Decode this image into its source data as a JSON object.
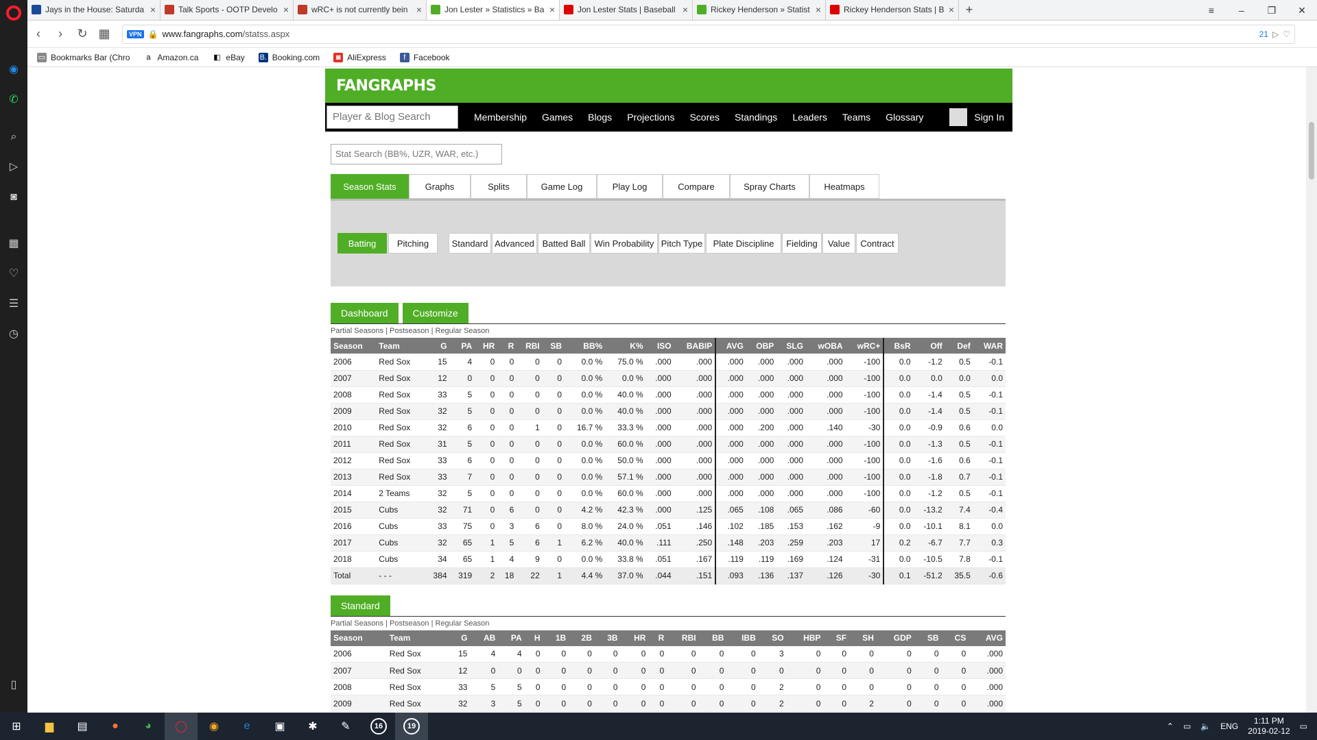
{
  "browser": {
    "tabs": [
      {
        "title": "Jays in the House: Saturda",
        "color": "#1a4a9a"
      },
      {
        "title": "Talk Sports - OOTP Develo",
        "color": "#c0392b"
      },
      {
        "title": "wRC+ is not currently bein",
        "color": "#c0392b"
      },
      {
        "title": "Jon Lester » Statistics » Ba",
        "color": "#50ae26"
      },
      {
        "title": "Jon Lester Stats | Baseball",
        "color": "#d00"
      },
      {
        "title": "Rickey Henderson » Statist",
        "color": "#50ae26"
      },
      {
        "title": "Rickey Henderson Stats | B",
        "color": "#d00"
      }
    ],
    "active_tab": 3,
    "url_domain": "www.fangraphs.com",
    "url_path": "/statss.aspx",
    "vpn_label": "VPN",
    "adblock_count": "21",
    "bookmarks": [
      {
        "label": "Bookmarks Bar (Chro",
        "icon": "folder-icon"
      },
      {
        "label": "Amazon.ca",
        "icon": "amazon-icon"
      },
      {
        "label": "eBay",
        "icon": "ebay-icon"
      },
      {
        "label": "Booking.com",
        "icon": "booking-icon"
      },
      {
        "label": "AliExpress",
        "icon": "aliexpress-icon"
      },
      {
        "label": "Facebook",
        "icon": "facebook-icon"
      }
    ]
  },
  "site": {
    "logo": "FANGRAPHS",
    "search_placeholder": "Player & Blog Search",
    "nav": [
      "Membership",
      "Games",
      "Blogs",
      "Projections",
      "Scores",
      "Standings",
      "Leaders",
      "Teams",
      "Glossary"
    ],
    "sign_in": "Sign In",
    "stat_search_placeholder": "Stat Search (BB%, UZR, WAR, etc.)",
    "main_tabs": [
      "Season Stats",
      "Graphs",
      "Splits",
      "Game Log",
      "Play Log",
      "Compare",
      "Spray Charts",
      "Heatmaps"
    ],
    "type_tabs": [
      "Batting",
      "Pitching"
    ],
    "stat_tabs": [
      "Standard",
      "Advanced",
      "Batted Ball",
      "Win Probability",
      "Pitch Type",
      "Plate Discipline",
      "Fielding",
      "Value",
      "Contract"
    ],
    "dashboard_label": "Dashboard",
    "customize_label": "Customize",
    "standard_label": "Standard",
    "subnav": [
      "Partial Seasons",
      "Postseason",
      "Regular Season"
    ],
    "accent": "#50ae26"
  },
  "dashboard": {
    "headers": [
      "Season",
      "Team",
      "G",
      "PA",
      "HR",
      "R",
      "RBI",
      "SB",
      "BB%",
      "K%",
      "ISO",
      "BABIP",
      "AVG",
      "OBP",
      "SLG",
      "wOBA",
      "wRC+",
      "BsR",
      "Off",
      "Def",
      "WAR"
    ],
    "rows": [
      [
        "2006",
        "Red Sox",
        "15",
        "4",
        "0",
        "0",
        "0",
        "0",
        "0.0 %",
        "75.0 %",
        ".000",
        ".000",
        ".000",
        ".000",
        ".000",
        ".000",
        "-100",
        "0.0",
        "-1.2",
        "0.5",
        "-0.1"
      ],
      [
        "2007",
        "Red Sox",
        "12",
        "0",
        "0",
        "0",
        "0",
        "0",
        "0.0 %",
        "0.0 %",
        ".000",
        ".000",
        ".000",
        ".000",
        ".000",
        ".000",
        "-100",
        "0.0",
        "0.0",
        "0.0",
        "0.0"
      ],
      [
        "2008",
        "Red Sox",
        "33",
        "5",
        "0",
        "0",
        "0",
        "0",
        "0.0 %",
        "40.0 %",
        ".000",
        ".000",
        ".000",
        ".000",
        ".000",
        ".000",
        "-100",
        "0.0",
        "-1.4",
        "0.5",
        "-0.1"
      ],
      [
        "2009",
        "Red Sox",
        "32",
        "5",
        "0",
        "0",
        "0",
        "0",
        "0.0 %",
        "40.0 %",
        ".000",
        ".000",
        ".000",
        ".000",
        ".000",
        ".000",
        "-100",
        "0.0",
        "-1.4",
        "0.5",
        "-0.1"
      ],
      [
        "2010",
        "Red Sox",
        "32",
        "6",
        "0",
        "0",
        "1",
        "0",
        "16.7 %",
        "33.3 %",
        ".000",
        ".000",
        ".000",
        ".200",
        ".000",
        ".140",
        "-30",
        "0.0",
        "-0.9",
        "0.6",
        "0.0"
      ],
      [
        "2011",
        "Red Sox",
        "31",
        "5",
        "0",
        "0",
        "0",
        "0",
        "0.0 %",
        "60.0 %",
        ".000",
        ".000",
        ".000",
        ".000",
        ".000",
        ".000",
        "-100",
        "0.0",
        "-1.3",
        "0.5",
        "-0.1"
      ],
      [
        "2012",
        "Red Sox",
        "33",
        "6",
        "0",
        "0",
        "0",
        "0",
        "0.0 %",
        "50.0 %",
        ".000",
        ".000",
        ".000",
        ".000",
        ".000",
        ".000",
        "-100",
        "0.0",
        "-1.6",
        "0.6",
        "-0.1"
      ],
      [
        "2013",
        "Red Sox",
        "33",
        "7",
        "0",
        "0",
        "0",
        "0",
        "0.0 %",
        "57.1 %",
        ".000",
        ".000",
        ".000",
        ".000",
        ".000",
        ".000",
        "-100",
        "0.0",
        "-1.8",
        "0.7",
        "-0.1"
      ],
      [
        "2014",
        "2 Teams",
        "32",
        "5",
        "0",
        "0",
        "0",
        "0",
        "0.0 %",
        "60.0 %",
        ".000",
        ".000",
        ".000",
        ".000",
        ".000",
        ".000",
        "-100",
        "0.0",
        "-1.2",
        "0.5",
        "-0.1"
      ],
      [
        "2015",
        "Cubs",
        "32",
        "71",
        "0",
        "6",
        "0",
        "0",
        "4.2 %",
        "42.3 %",
        ".000",
        ".125",
        ".065",
        ".108",
        ".065",
        ".086",
        "-60",
        "0.0",
        "-13.2",
        "7.4",
        "-0.4"
      ],
      [
        "2016",
        "Cubs",
        "33",
        "75",
        "0",
        "3",
        "6",
        "0",
        "8.0 %",
        "24.0 %",
        ".051",
        ".146",
        ".102",
        ".185",
        ".153",
        ".162",
        "-9",
        "0.0",
        "-10.1",
        "8.1",
        "0.0"
      ],
      [
        "2017",
        "Cubs",
        "32",
        "65",
        "1",
        "5",
        "6",
        "1",
        "6.2 %",
        "40.0 %",
        ".111",
        ".250",
        ".148",
        ".203",
        ".259",
        ".203",
        "17",
        "0.2",
        "-6.7",
        "7.7",
        "0.3"
      ],
      [
        "2018",
        "Cubs",
        "34",
        "65",
        "1",
        "4",
        "9",
        "0",
        "0.0 %",
        "33.8 %",
        ".051",
        ".167",
        ".119",
        ".119",
        ".169",
        ".124",
        "-31",
        "0.0",
        "-10.5",
        "7.8",
        "-0.1"
      ]
    ],
    "total": [
      "Total",
      "- - -",
      "384",
      "319",
      "2",
      "18",
      "22",
      "1",
      "4.4 %",
      "37.0 %",
      ".044",
      ".151",
      ".093",
      ".136",
      ".137",
      ".126",
      "-30",
      "0.1",
      "-51.2",
      "35.5",
      "-0.6"
    ]
  },
  "standard": {
    "headers": [
      "Season",
      "Team",
      "G",
      "AB",
      "PA",
      "H",
      "1B",
      "2B",
      "3B",
      "HR",
      "R",
      "RBI",
      "BB",
      "IBB",
      "SO",
      "HBP",
      "SF",
      "SH",
      "GDP",
      "SB",
      "CS",
      "AVG"
    ],
    "rows": [
      [
        "2006",
        "Red Sox",
        "15",
        "4",
        "4",
        "0",
        "0",
        "0",
        "0",
        "0",
        "0",
        "0",
        "0",
        "0",
        "3",
        "0",
        "0",
        "0",
        "0",
        "0",
        "0",
        ".000"
      ],
      [
        "2007",
        "Red Sox",
        "12",
        "0",
        "0",
        "0",
        "0",
        "0",
        "0",
        "0",
        "0",
        "0",
        "0",
        "0",
        "0",
        "0",
        "0",
        "0",
        "0",
        "0",
        "0",
        ".000"
      ],
      [
        "2008",
        "Red Sox",
        "33",
        "5",
        "5",
        "0",
        "0",
        "0",
        "0",
        "0",
        "0",
        "0",
        "0",
        "0",
        "2",
        "0",
        "0",
        "0",
        "0",
        "0",
        "0",
        ".000"
      ],
      [
        "2009",
        "Red Sox",
        "32",
        "3",
        "5",
        "0",
        "0",
        "0",
        "0",
        "0",
        "0",
        "0",
        "0",
        "0",
        "2",
        "0",
        "0",
        "2",
        "0",
        "0",
        "0",
        ".000"
      ]
    ]
  },
  "taskbar": {
    "lang": "ENG",
    "time": "1:11 PM",
    "date": "2019-02-12",
    "badges": [
      "16",
      "19"
    ]
  }
}
